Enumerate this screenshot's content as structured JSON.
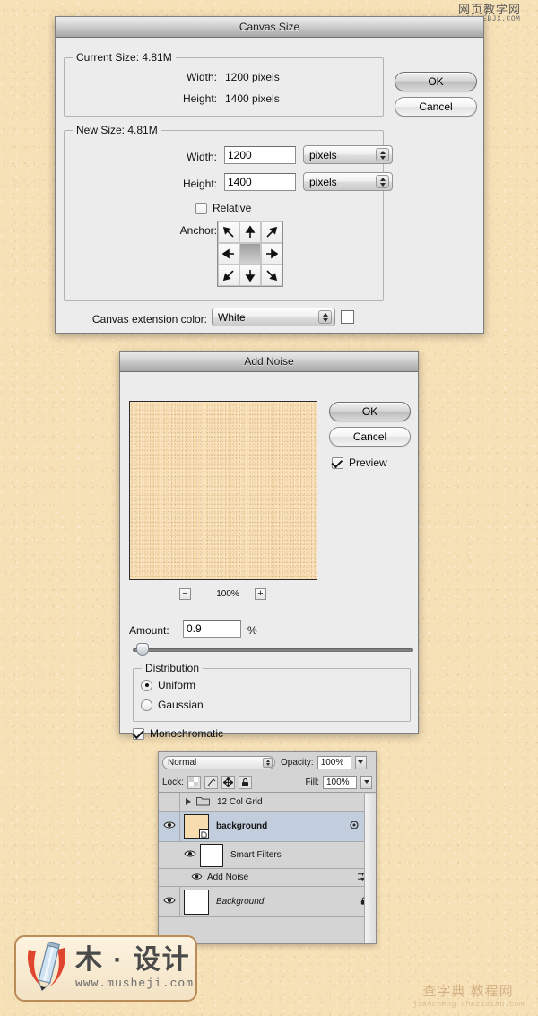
{
  "canvas_size_dialog": {
    "title": "Canvas Size",
    "current_size": {
      "legend": "Current Size: 4.81M",
      "width_label": "Width:",
      "width_value": "1200 pixels",
      "height_label": "Height:",
      "height_value": "1400 pixels"
    },
    "new_size": {
      "legend": "New Size: 4.81M",
      "width_label": "Width:",
      "width_value": "1200",
      "width_unit": "pixels",
      "height_label": "Height:",
      "height_value": "1400",
      "height_unit": "pixels",
      "relative_label": "Relative",
      "relative_checked": false,
      "anchor_label": "Anchor:"
    },
    "extension": {
      "label": "Canvas extension color:",
      "value": "White",
      "swatch_color": "#ffffff"
    },
    "buttons": {
      "ok": "OK",
      "cancel": "Cancel"
    }
  },
  "add_noise_dialog": {
    "title": "Add Noise",
    "buttons": {
      "ok": "OK",
      "cancel": "Cancel"
    },
    "preview_label": "Preview",
    "preview_checked": true,
    "zoom_level": "100%",
    "zoom_out": "−",
    "zoom_in": "+",
    "amount_label": "Amount:",
    "amount_value": "0.9",
    "amount_unit": "%",
    "amount_slider_percent": 2,
    "distribution": {
      "legend": "Distribution",
      "options": [
        {
          "label": "Uniform",
          "selected": true
        },
        {
          "label": "Gaussian",
          "selected": false
        }
      ]
    },
    "monochromatic_label": "Monochromatic",
    "monochromatic_checked": true
  },
  "layers_palette": {
    "blend_mode": "Normal",
    "opacity_label": "Opacity:",
    "opacity_value": "100%",
    "lock_label": "Lock:",
    "fill_label": "Fill:",
    "fill_value": "100%",
    "lock_icons": [
      "transparency-lock-icon",
      "brush-lock-icon",
      "move-lock-icon",
      "lock-all-icon"
    ],
    "layers": [
      {
        "name": "12 Col Grid",
        "type": "group",
        "visible": false,
        "selected": false
      },
      {
        "name": "background",
        "type": "smart-object",
        "visible": true,
        "selected": true
      },
      {
        "name": "Smart Filters",
        "type": "smart-filters",
        "visible": true,
        "selected": false
      },
      {
        "name": "Add Noise",
        "type": "filter",
        "visible": true,
        "selected": false
      },
      {
        "name": "Background",
        "type": "background",
        "visible": true,
        "selected": false,
        "locked": true
      }
    ]
  },
  "watermarks": {
    "top_right_cn": "网页教学网",
    "top_right_url": "WWW.WEBJX.COM",
    "bottom_left_cn": "木 · 设计",
    "bottom_left_url": "www.musheji.com",
    "bottom_right_cn": "查字典 教程网",
    "bottom_right_url": "jiaocheng.chazidian.com"
  }
}
